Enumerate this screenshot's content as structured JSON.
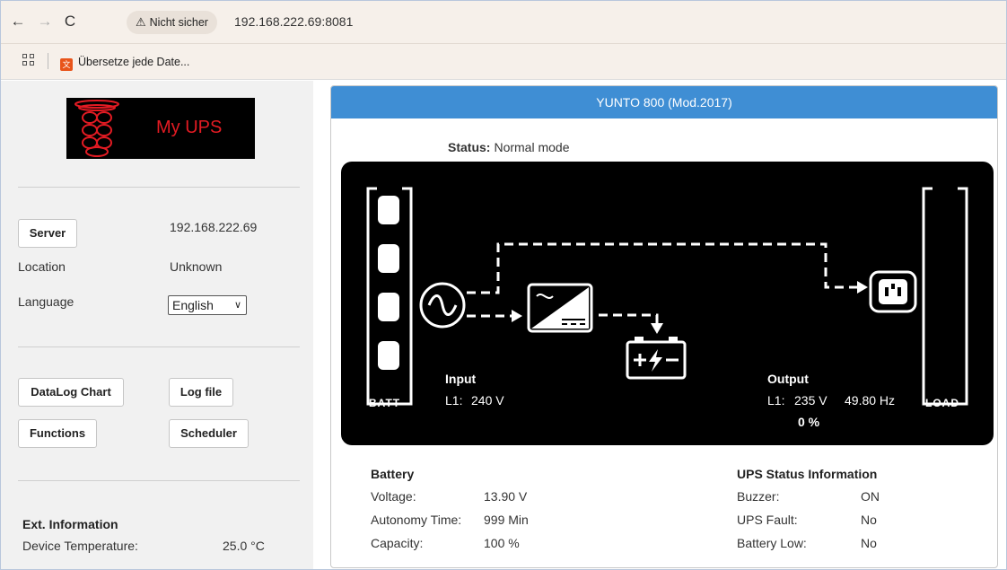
{
  "browser": {
    "security_label": "Nicht sicher",
    "url": "192.168.222.69:8081",
    "bookmark_label": "Übersetze jede Date..."
  },
  "sidebar": {
    "logo_text": "My UPS",
    "server_button": "Server",
    "server_ip": "192.168.222.69",
    "location_label": "Location",
    "location_value": "Unknown",
    "language_label": "Language",
    "language_selected": "English",
    "buttons": {
      "datalog_chart": "DataLog Chart",
      "log_file": "Log file",
      "functions": "Functions",
      "scheduler": "Scheduler"
    },
    "ext_info_title": "Ext. Information",
    "device_temp_label": "Device Temperature:",
    "device_temp_value": "25.0 °C"
  },
  "panel": {
    "title": "YUNTO 800 (Mod.2017)",
    "status_label": "Status:",
    "status_value": "Normal mode",
    "lcd": {
      "batt_label": "BATT",
      "load_label": "LOAD",
      "input_title": "Input",
      "input_line": "L1:",
      "input_voltage": "240 V",
      "output_title": "Output",
      "output_line": "L1:",
      "output_voltage": "235 V",
      "output_frequency": "49.80 Hz",
      "output_load": "0 %"
    },
    "battery": {
      "title": "Battery",
      "voltage_label": "Voltage:",
      "voltage_value": "13.90 V",
      "autonomy_label": "Autonomy Time:",
      "autonomy_value": "999 Min",
      "capacity_label": "Capacity:",
      "capacity_value": "100 %"
    },
    "ups_status": {
      "title": "UPS Status Information",
      "buzzer_label": "Buzzer:",
      "buzzer_value": "ON",
      "fault_label": "UPS Fault:",
      "fault_value": "No",
      "battlow_label": "Battery Low:",
      "battlow_value": "No"
    }
  }
}
